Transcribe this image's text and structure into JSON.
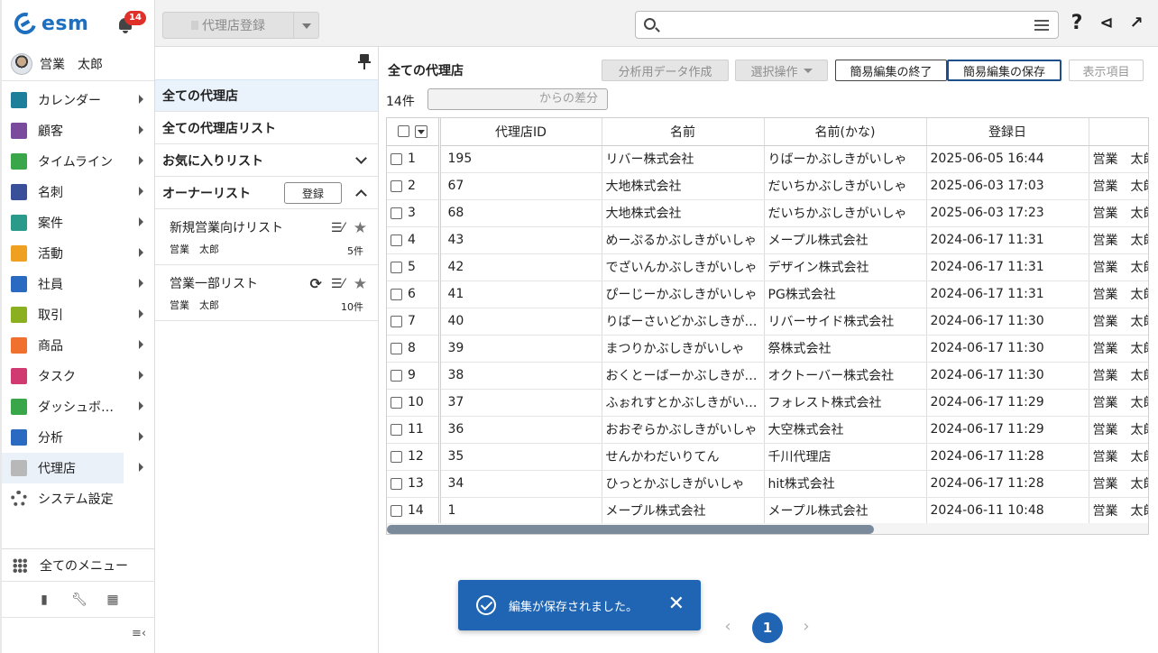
{
  "app": {
    "logo_text": "esm",
    "notification_count": "14"
  },
  "user": {
    "name": "営業　太郎"
  },
  "nav": {
    "items": [
      {
        "label": "カレンダー",
        "icon": "calendar-icon",
        "color": "#1d7f9a",
        "arrow": true
      },
      {
        "label": "顧客",
        "icon": "building-icon",
        "color": "#7a4a9c",
        "arrow": true
      },
      {
        "label": "タイムライン",
        "icon": "chat-icon",
        "color": "#3aa64a",
        "arrow": true
      },
      {
        "label": "名刺",
        "icon": "card-icon",
        "color": "#3a4f9a",
        "arrow": true
      },
      {
        "label": "案件",
        "icon": "folder-icon",
        "color": "#2a9a8a",
        "arrow": true
      },
      {
        "label": "活動",
        "icon": "clipboard-icon",
        "color": "#f0a020",
        "arrow": true
      },
      {
        "label": "社員",
        "icon": "person-icon",
        "color": "#2a6ac0",
        "arrow": true
      },
      {
        "label": "取引",
        "icon": "deal-icon",
        "color": "#8ab020",
        "arrow": true
      },
      {
        "label": "商品",
        "icon": "product-icon",
        "color": "#f07030",
        "arrow": true
      },
      {
        "label": "タスク",
        "icon": "task-icon",
        "color": "#d03a70",
        "arrow": true
      },
      {
        "label": "ダッシュボ…",
        "icon": "dashboard-icon",
        "color": "#3aa64a",
        "arrow": true
      },
      {
        "label": "分析",
        "icon": "chart-icon",
        "color": "#2a6ac0",
        "arrow": true
      },
      {
        "label": "代理店",
        "icon": "agency-icon",
        "color": "#b8b8b8",
        "arrow": true
      },
      {
        "label": "システム設定",
        "icon": "gear-icon",
        "color": "#555555",
        "arrow": false
      }
    ],
    "all_menu_label": "全てのメニュー"
  },
  "toolbar": {
    "register_label": "代理店登録"
  },
  "lists": {
    "all_agencies": "全ての代理店",
    "all_agency_lists": "全ての代理店リスト",
    "favorites": "お気に入りリスト",
    "owner_lists": "オーナーリスト",
    "owner_register_label": "登録",
    "sub_items": [
      {
        "title": "新規営業向けリスト",
        "owner": "営業　太郎",
        "count": "5件"
      },
      {
        "title": "営業一部リスト",
        "owner": "営業　太郎",
        "count": "10件"
      }
    ]
  },
  "main": {
    "title": "全ての代理店",
    "btn_analysis": "分析用データ作成",
    "btn_select_ops": "選択操作",
    "btn_end_edit": "簡易編集の終了",
    "btn_save_edit": "簡易編集の保存",
    "btn_display_items": "表示項目",
    "count": "14件",
    "diff_placeholder": "からの差分"
  },
  "table": {
    "columns": [
      "代理店ID",
      "名前",
      "名前(かな)",
      "登録日",
      ""
    ],
    "rows": [
      {
        "n": "1",
        "id": "195",
        "name": "リバー株式会社",
        "kana": "りばーかぶしきがいしゃ",
        "date": "2025-06-05 16:44",
        "owner": "営業　太郎"
      },
      {
        "n": "2",
        "id": "67",
        "name": "大地株式会社",
        "kana": "だいちかぶしきがいしゃ",
        "date": "2025-06-03 17:03",
        "owner": "営業　太郎"
      },
      {
        "n": "3",
        "id": "68",
        "name": "大地株式会社",
        "kana": "だいちかぶしきがいしゃ",
        "date": "2025-06-03 17:23",
        "owner": "営業　太郎"
      },
      {
        "n": "4",
        "id": "43",
        "name": "めーぷるかぶしきがいしゃ",
        "kana": "メープル株式会社",
        "date": "2024-06-17 11:31",
        "owner": "営業　太郎"
      },
      {
        "n": "5",
        "id": "42",
        "name": "でざいんかぶしきがいしゃ",
        "kana": "デザイン株式会社",
        "date": "2024-06-17 11:31",
        "owner": "営業　太郎"
      },
      {
        "n": "6",
        "id": "41",
        "name": "ぴーじーかぶしきがいしゃ",
        "kana": "PG株式会社",
        "date": "2024-06-17 11:31",
        "owner": "営業　太郎"
      },
      {
        "n": "7",
        "id": "40",
        "name": "りばーさいどかぶしきが…",
        "kana": "リバーサイド株式会社",
        "date": "2024-06-17 11:30",
        "owner": "営業　太郎"
      },
      {
        "n": "8",
        "id": "39",
        "name": "まつりかぶしきがいしゃ",
        "kana": "祭株式会社",
        "date": "2024-06-17 11:30",
        "owner": "営業　太郎"
      },
      {
        "n": "9",
        "id": "38",
        "name": "おくとーばーかぶしきが…",
        "kana": "オクトーバー株式会社",
        "date": "2024-06-17 11:30",
        "owner": "営業　太郎"
      },
      {
        "n": "10",
        "id": "37",
        "name": "ふぉれすとかぶしきがい…",
        "kana": "フォレスト株式会社",
        "date": "2024-06-17 11:29",
        "owner": "営業　太郎"
      },
      {
        "n": "11",
        "id": "36",
        "name": "おおぞらかぶしきがいしゃ",
        "kana": "大空株式会社",
        "date": "2024-06-17 11:29",
        "owner": "営業　太郎"
      },
      {
        "n": "12",
        "id": "35",
        "name": "せんかわだいりてん",
        "kana": "千川代理店",
        "date": "2024-06-17 11:28",
        "owner": "営業　太郎"
      },
      {
        "n": "13",
        "id": "34",
        "name": "ひっとかぶしきがいしゃ",
        "kana": "hit株式会社",
        "date": "2024-06-17 11:28",
        "owner": "営業　太郎"
      },
      {
        "n": "14",
        "id": "1",
        "name": "メープル株式会社",
        "kana": "メープル株式会社",
        "date": "2024-06-11 10:48",
        "owner": "営業　太郎"
      }
    ]
  },
  "toast": {
    "message": "編集が保存されました。"
  },
  "pagination": {
    "current": "1",
    "prev": "‹",
    "next": "›"
  }
}
